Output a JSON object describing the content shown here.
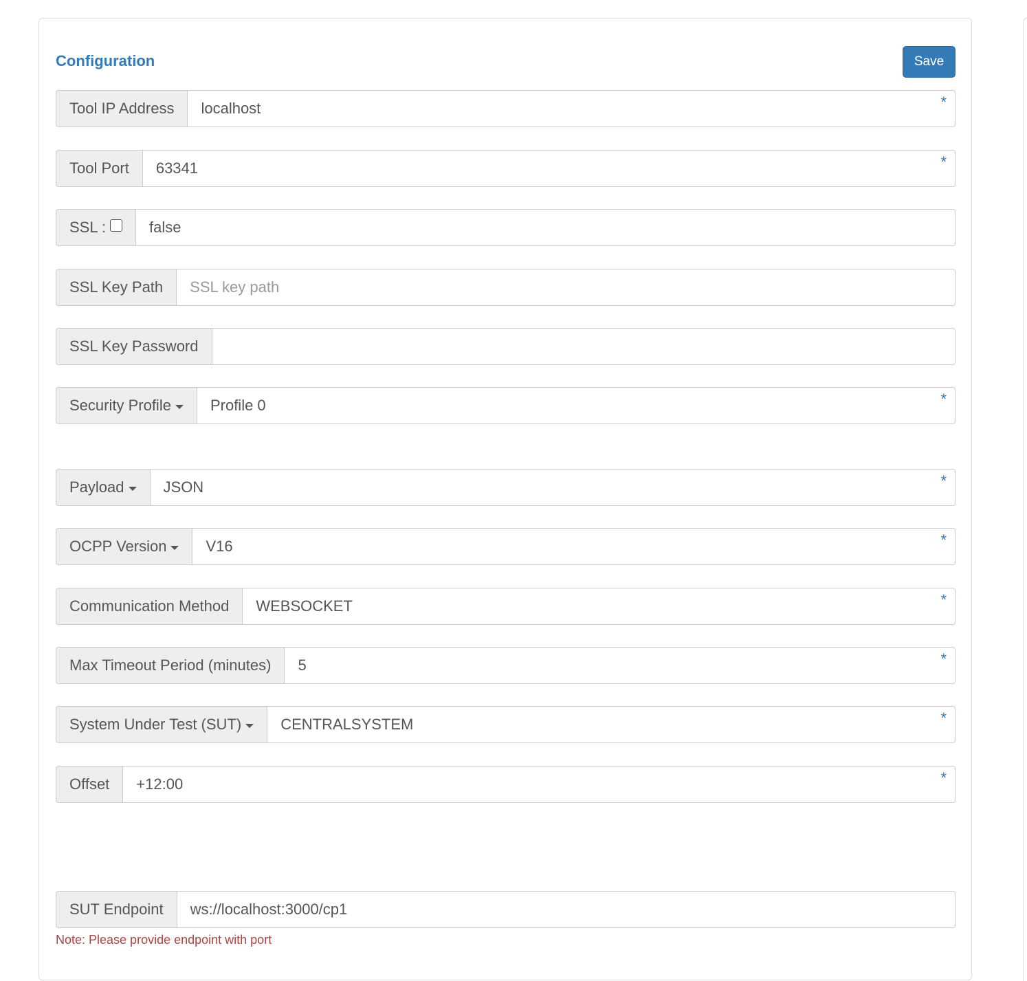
{
  "header": {
    "title": "Configuration",
    "save_label": "Save"
  },
  "required_marker": "*",
  "fields": [
    {
      "label": "Tool IP Address",
      "value": "localhost",
      "required": true
    },
    {
      "label": "Tool Port",
      "value": "63341",
      "required": true
    },
    {
      "label": "SSL :",
      "value": "false",
      "checkbox_checked": false
    },
    {
      "label": "SSL Key Path",
      "value": "",
      "placeholder": "SSL key path"
    },
    {
      "label": "SSL Key Password",
      "value": ""
    },
    {
      "label": "Security Profile",
      "value": "Profile 0",
      "dropdown": true,
      "required": true
    },
    {
      "label": "Payload",
      "value": "JSON",
      "dropdown": true,
      "required": true
    },
    {
      "label": "OCPP Version",
      "value": "V16",
      "dropdown": true,
      "required": true
    },
    {
      "label": "Communication Method",
      "value": "WEBSOCKET",
      "required": true
    },
    {
      "label": "Max Timeout Period (minutes)",
      "value": "5",
      "required": true
    },
    {
      "label": "System Under Test (SUT)",
      "value": "CENTRALSYSTEM",
      "dropdown": true,
      "required": true
    },
    {
      "label": "Offset",
      "value": "+12:00",
      "required": true
    },
    {
      "label": "SUT Endpoint",
      "value": "ws://localhost:3000/cp1"
    }
  ],
  "note": "Note: Please provide endpoint with port",
  "colors": {
    "accent": "#337ab7",
    "addon_bg": "#eeeeee",
    "border": "#cccccc",
    "note": "#a94442"
  }
}
